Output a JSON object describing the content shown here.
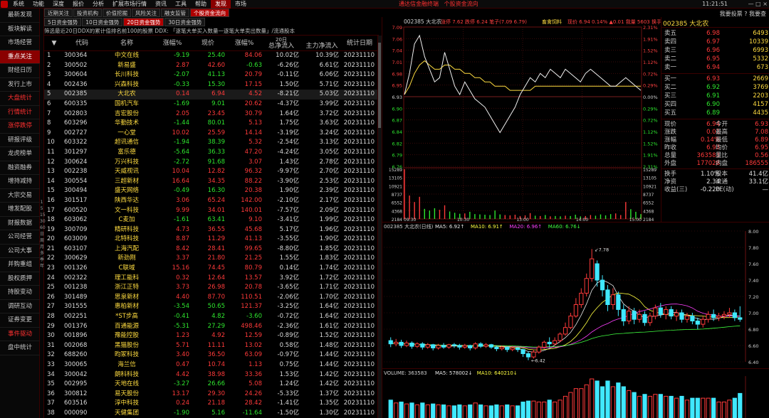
{
  "menubar": {
    "items": [
      "系统",
      "功能",
      "深度",
      "报价",
      "分析",
      "扩展市场行情",
      "资讯",
      "工具",
      "帮助",
      "发现",
      "市场"
    ],
    "active_index": 9,
    "marquee1": "通达信金融终端",
    "marquee2": "个股资金流向",
    "clock": "11:21:51",
    "window_controls": "—  □  ×"
  },
  "sidebar": {
    "items": [
      {
        "label": "最新发现"
      },
      {
        "label": "板块解读"
      },
      {
        "label": "市场经营"
      },
      {
        "label": "重点关注",
        "selected": true
      },
      {
        "label": "财经日历"
      },
      {
        "label": "发行上市"
      },
      {
        "label": "大盘统计",
        "red": true
      },
      {
        "label": "行情统计",
        "red": true
      },
      {
        "label": "涨停跌停",
        "red": true
      },
      {
        "label": "研报评级"
      },
      {
        "label": "龙虎榜单"
      },
      {
        "label": "融资融券"
      },
      {
        "label": "增持减持"
      },
      {
        "label": "大宗交易"
      },
      {
        "label": "增发配股"
      },
      {
        "label": "财报数据"
      },
      {
        "label": "公司经营"
      },
      {
        "label": "公司大事"
      },
      {
        "label": "并购重组"
      },
      {
        "label": "股权质押"
      },
      {
        "label": "持股变动"
      },
      {
        "label": "调研互动"
      },
      {
        "label": "证券变更"
      },
      {
        "label": "事件驱动",
        "red": true
      },
      {
        "label": "盘中统计"
      }
    ],
    "strip": [
      "1",
      "5",
      "15",
      "30",
      "60",
      "日",
      "周",
      "月",
      "多",
      "季",
      "年"
    ]
  },
  "tabs_row1": [
    "近期关注",
    "投资机构",
    "价值挖掘",
    "风险关注",
    "融支监管",
    "个股资金流向"
  ],
  "tabs_row1_active": 5,
  "tabs_row2": [
    "5日资金强势",
    "10日资金强势",
    "20日资金强势",
    "30日资金强势"
  ],
  "tabs_row2_active": 2,
  "toolbar_right": "我要投票  ?  我要查",
  "filter_text": "筛选最近20日DDX的累计值排名前100的股票  DDX: 「逐笔大单买入数量一逐笔大单卖出数量」/流通股本",
  "table": {
    "period_label": "20日",
    "headers": {
      "idx": "",
      "code": "代码",
      "name": "名称",
      "chg": "涨幅%",
      "price": "现价",
      "rate": "涨幅%",
      "net": "总净流入",
      "main": "主力净流入",
      "date": "统计日期"
    },
    "rows": [
      [
        "1",
        "300364",
        "中文在线",
        "-9.19",
        "25.40",
        "84.06",
        "10.02亿",
        "10.39亿",
        "20231110"
      ],
      [
        "2",
        "300502",
        "新易盛",
        "2.87",
        "42.60",
        "-0.63",
        "-6.26亿",
        "6.61亿",
        "20231110"
      ],
      [
        "3",
        "300604",
        "长川科技",
        "-2.07",
        "41.13",
        "20.79",
        "-0.11亿",
        "6.06亿",
        "20231110"
      ],
      [
        "4",
        "002436",
        "兴森科技",
        "-0.33",
        "15.30",
        "17.15",
        "1.50亿",
        "5.71亿",
        "20231110"
      ],
      [
        "5",
        "002385",
        "大北农",
        "0.14",
        "6.94",
        "4.52",
        "-8.21亿",
        "5.03亿",
        "20231110"
      ],
      [
        "6",
        "600335",
        "国机汽车",
        "-1.69",
        "9.01",
        "20.62",
        "-4.37亿",
        "3.99亿",
        "20231110"
      ],
      [
        "7",
        "002803",
        "吉宏股份",
        "2.05",
        "23.45",
        "30.79",
        "1.64亿",
        "3.72亿",
        "20231110"
      ],
      [
        "8",
        "603296",
        "华勤技术",
        "-1.44",
        "80.01",
        "5.13",
        "1.75亿",
        "3.63亿",
        "20231110"
      ],
      [
        "9",
        "002727",
        "一心堂",
        "10.02",
        "25.59",
        "14.14",
        "-3.19亿",
        "3.24亿",
        "20231110"
      ],
      [
        "10",
        "603322",
        "超讯通信",
        "-1.94",
        "38.39",
        "5.32",
        "-2.54亿",
        "3.13亿",
        "20231110"
      ],
      [
        "11",
        "301297",
        "富乐德",
        "-5.64",
        "36.33",
        "47.20",
        "-4.24亿",
        "3.05亿",
        "20231110"
      ],
      [
        "12",
        "300624",
        "万兴科技",
        "-2.72",
        "91.68",
        "3.07",
        "1.43亿",
        "2.78亿",
        "20231110"
      ],
      [
        "13",
        "002238",
        "天威视讯",
        "10.04",
        "12.82",
        "96.32",
        "-9.97亿",
        "2.70亿",
        "20231110"
      ],
      [
        "14",
        "300554",
        "三超新材",
        "16.64",
        "34.35",
        "88.22",
        "-3.90亿",
        "2.53亿",
        "20231110"
      ],
      [
        "15",
        "300494",
        "盛天网络",
        "-0.49",
        "16.30",
        "20.38",
        "1.90亿",
        "2.39亿",
        "20231110"
      ],
      [
        "16",
        "301517",
        "陕西华达",
        "3.06",
        "65.24",
        "142.00",
        "-2.10亿",
        "2.17亿",
        "20231110"
      ],
      [
        "17",
        "600520",
        "文一科技",
        "9.99",
        "34.01",
        "140.01",
        "-7.57亿",
        "2.09亿",
        "20231110"
      ],
      [
        "18",
        "603062",
        "C麦加",
        "-1.61",
        "63.41",
        "9.10",
        "-3.41亿",
        "1.99亿",
        "20231110"
      ],
      [
        "19",
        "300709",
        "精研科技",
        "4.73",
        "36.55",
        "45.68",
        "5.17亿",
        "1.96亿",
        "20231110"
      ],
      [
        "20",
        "603009",
        "北特科技",
        "8.87",
        "11.29",
        "41.13",
        "-3.55亿",
        "1.90亿",
        "20231110"
      ],
      [
        "21",
        "603107",
        "上海汽配",
        "8.42",
        "28.41",
        "99.65",
        "-8.80亿",
        "1.85亿",
        "20231110"
      ],
      [
        "22",
        "300629",
        "新劲刚",
        "3.37",
        "21.80",
        "21.25",
        "1.55亿",
        "1.83亿",
        "20231110"
      ],
      [
        "23",
        "001326",
        "C联域",
        "15.16",
        "74.45",
        "80.79",
        "0.14亿",
        "1.74亿",
        "20231110"
      ],
      [
        "24",
        "002322",
        "理工能科",
        "0.32",
        "12.64",
        "13.57",
        "3.92亿",
        "1.72亿",
        "20231110"
      ],
      [
        "25",
        "001238",
        "浙江正特",
        "3.73",
        "26.98",
        "20.78",
        "-3.65亿",
        "1.71亿",
        "20231110"
      ],
      [
        "26",
        "301489",
        "思泉新材",
        "4.40",
        "87.70",
        "110.51",
        "-2.06亿",
        "1.70亿",
        "20231110"
      ],
      [
        "27",
        "301555",
        "惠柏新材",
        "-3.54",
        "50.65",
        "121.37",
        "-3.25亿",
        "1.64亿",
        "20231110"
      ],
      [
        "28",
        "002251",
        "*ST步高",
        "-0.41",
        "4.82",
        "-3.60",
        "-0.72亿",
        "1.64亿",
        "20231110"
      ],
      [
        "29",
        "001376",
        "百通能源",
        "-5.31",
        "27.29",
        "498.46",
        "-2.36亿",
        "1.61亿",
        "20231110"
      ],
      [
        "30",
        "001896",
        "豫能控股",
        "1.23",
        "4.92",
        "12.59",
        "-0.89亿",
        "1.52亿",
        "20231110"
      ],
      [
        "31",
        "002068",
        "黑猫股份",
        "5.71",
        "11.11",
        "13.02",
        "0.58亿",
        "1.48亿",
        "20231110"
      ],
      [
        "32",
        "688260",
        "昀冢科技",
        "3.40",
        "36.50",
        "63.09",
        "-0.97亿",
        "1.44亿",
        "20231110"
      ],
      [
        "33",
        "300065",
        "海兰信",
        "0.47",
        "10.74",
        "1.13",
        "0.75亿",
        "1.44亿",
        "20231110"
      ],
      [
        "34",
        "300042",
        "朗科科技",
        "4.42",
        "38.98",
        "33.36",
        "1.53亿",
        "1.42亿",
        "20231110"
      ],
      [
        "35",
        "002995",
        "天地在线",
        "-3.27",
        "26.66",
        "5.08",
        "1.24亿",
        "1.42亿",
        "20231110"
      ],
      [
        "36",
        "300812",
        "易天股份",
        "13.17",
        "29.30",
        "24.26",
        "-5.33亿",
        "1.37亿",
        "20231110"
      ],
      [
        "37",
        "603516",
        "淳中科技",
        "0.24",
        "21.18",
        "28.42",
        "-1.41亿",
        "1.35亿",
        "20231110"
      ],
      [
        "38",
        "000090",
        "天健集团",
        "-1.90",
        "5.16",
        "-11.64",
        "-1.50亿",
        "1.30亿",
        "20231110"
      ]
    ]
  },
  "intraday": {
    "header": "002385 大北农",
    "stats": "涨停 7.62  跌停 6.24  笔子(7.09 6.79)",
    "tag": "畜禽饲料",
    "price_text": "现价 6.94  0.14%  ▲0.01  我量 5603  换手 1.10%",
    "price_axis": [
      "7.09",
      "7.06",
      "7.04",
      "7.01",
      "6.98",
      "6.95",
      "6.93",
      "6.90",
      "6.87",
      "6.84",
      "6.82",
      "6.79",
      "6.76"
    ],
    "pct_axis": [
      "2.31%",
      "1.91%",
      "1.52%",
      "1.12%",
      "0.72%",
      "0.29%",
      "0.00%",
      "0.29%",
      "0.72%",
      "1.12%",
      "1.52%",
      "1.91%",
      "2.31%"
    ],
    "vol_axis": [
      "15289",
      "13105",
      "10921",
      "8737",
      "6552",
      "4368",
      "2184"
    ],
    "time_axis": [
      "09:30",
      "10:30",
      "13:00",
      "14:00",
      "15:00"
    ],
    "price_series": [
      6.93,
      6.98,
      7.05,
      7.07,
      7.02,
      6.99,
      6.96,
      6.97,
      7.03,
      6.99,
      6.95,
      6.93,
      6.96,
      6.94,
      6.92,
      6.91,
      6.9,
      6.88,
      6.86,
      6.84,
      6.86,
      6.88,
      6.9,
      6.93,
      6.95,
      6.97,
      6.96,
      6.98,
      6.97,
      6.99,
      6.98,
      6.97,
      6.99,
      6.98,
      6.97,
      6.96,
      6.98,
      6.99,
      6.98,
      6.97,
      6.96,
      6.95,
      6.95,
      6.96,
      6.97,
      6.96,
      6.95,
      6.94
    ],
    "avg_series": [
      6.93,
      6.95,
      6.98,
      7.0,
      7.01,
      7.0,
      6.99,
      6.99,
      7.0,
      7.0,
      6.99,
      6.99,
      6.98,
      6.98,
      6.97,
      6.97,
      6.96,
      6.96,
      6.95,
      6.95,
      6.95,
      6.94,
      6.94,
      6.94,
      6.94,
      6.94,
      6.95,
      6.95,
      6.95,
      6.95,
      6.95,
      6.95,
      6.95,
      6.95,
      6.95,
      6.95,
      6.95,
      6.95,
      6.95,
      6.95,
      6.95,
      6.95,
      6.95,
      6.95,
      6.95,
      6.95,
      6.95,
      6.95
    ],
    "volume_series": [
      15289,
      7200,
      5200,
      6800,
      3100,
      2600,
      3300,
      2800,
      4200,
      2300,
      1900,
      1600,
      1700,
      2200,
      1500,
      1400,
      1300,
      1200,
      2600,
      1400,
      1200,
      1100,
      1300,
      900,
      1100,
      1800,
      1000,
      900,
      1200,
      800,
      900,
      800,
      1000,
      900,
      1300,
      800,
      900,
      1200,
      1000,
      1400,
      1100,
      1500,
      1700,
      1200,
      5200,
      3000,
      2200,
      1500
    ]
  },
  "quote": {
    "title": "002385 大北农",
    "asks": [
      {
        "label": "卖五",
        "price": "6.98",
        "vol": "6493"
      },
      {
        "label": "卖四",
        "price": "6.97",
        "vol": "10339"
      },
      {
        "label": "卖三",
        "price": "6.96",
        "vol": "6993"
      },
      {
        "label": "卖二",
        "price": "6.95",
        "vol": "5332"
      },
      {
        "label": "卖一",
        "price": "6.94",
        "vol": "673"
      }
    ],
    "bids": [
      {
        "label": "买一",
        "price": "6.93",
        "vol": "2669"
      },
      {
        "label": "买二",
        "price": "6.92",
        "vol": "3769"
      },
      {
        "label": "买三",
        "price": "6.91",
        "vol": "2203"
      },
      {
        "label": "买四",
        "price": "6.90",
        "vol": "4157"
      },
      {
        "label": "买五",
        "price": "6.89",
        "vol": "4435"
      }
    ],
    "stats": [
      {
        "l1": "现价",
        "v1": "6.94",
        "l2": "今开",
        "v2": "6.93"
      },
      {
        "l1": "涨跌",
        "v1": "0.01",
        "l2": "最高",
        "v2": "7.08"
      },
      {
        "l1": "涨幅",
        "v1": "0.14%",
        "l2": "最低",
        "v2": "6.89"
      },
      {
        "l1": "昨收",
        "v1": "6.93",
        "l2": "均价",
        "v2": "6.95"
      },
      {
        "l1": "总量",
        "v1": "363583",
        "l2": "量比",
        "v2": "0.56"
      },
      {
        "l1": "外盘",
        "v1": "177028",
        "l2": "内盘",
        "v2": "186555"
      }
    ],
    "stats2": [
      {
        "l1": "换手",
        "v1": "1.10%",
        "l2": "股本",
        "v2": "41.4亿"
      },
      {
        "l1": "净资",
        "v1": "2.34",
        "l2": "流通",
        "v2": "33.1亿"
      },
      {
        "l1": "收益(三)",
        "v1": "-0.220",
        "l2": "PE(动)",
        "v2": "—"
      }
    ]
  },
  "kline": {
    "header": "002385 大北农(日线)",
    "ma_labels": [
      {
        "text": "MA5: 6.92↑",
        "color": "#e8e8e8"
      },
      {
        "text": "MA10: 6.91↑",
        "color": "#ffff40"
      },
      {
        "text": "MA20: 6.96↑",
        "color": "#ff40ff"
      },
      {
        "text": "MA60: 6.76↓",
        "color": "#40ff40"
      }
    ],
    "y_axis": [
      "8.00",
      "7.80",
      "7.60",
      "7.40",
      "7.20",
      "7.00",
      "6.80",
      "6.60",
      "6.40"
    ],
    "high_label": "7.78",
    "low_label": "6.42",
    "candles": [
      [
        6.66,
        6.62,
        6.7,
        6.58
      ],
      [
        6.62,
        6.64,
        6.68,
        6.59
      ],
      [
        6.64,
        6.6,
        6.67,
        6.57
      ],
      [
        6.6,
        6.63,
        6.66,
        6.58
      ],
      [
        6.63,
        6.59,
        6.65,
        6.56
      ],
      [
        6.59,
        6.62,
        6.64,
        6.57
      ],
      [
        6.62,
        6.58,
        6.64,
        6.55
      ],
      [
        6.58,
        6.61,
        6.63,
        6.56
      ],
      [
        6.61,
        6.57,
        6.62,
        6.54
      ],
      [
        6.57,
        6.6,
        6.62,
        6.55
      ],
      [
        6.6,
        6.58,
        6.63,
        6.56
      ],
      [
        6.58,
        6.61,
        6.62,
        6.56
      ],
      [
        6.61,
        6.6,
        6.63,
        6.57
      ],
      [
        6.6,
        6.58,
        6.62,
        6.55
      ],
      [
        6.58,
        6.6,
        6.62,
        6.56
      ],
      [
        6.6,
        6.57,
        6.61,
        6.54
      ],
      [
        6.57,
        6.62,
        6.64,
        6.55
      ],
      [
        6.62,
        6.59,
        6.64,
        6.57
      ],
      [
        6.59,
        6.61,
        6.63,
        6.57
      ],
      [
        6.61,
        6.58,
        6.62,
        6.56
      ],
      [
        6.58,
        6.56,
        6.6,
        6.53
      ],
      [
        6.56,
        6.58,
        6.6,
        6.54
      ],
      [
        6.58,
        6.55,
        6.59,
        6.52
      ],
      [
        6.55,
        6.57,
        6.59,
        6.53
      ],
      [
        6.57,
        6.55,
        6.58,
        6.52
      ],
      [
        6.55,
        6.5,
        6.56,
        6.46
      ],
      [
        6.5,
        6.46,
        6.53,
        6.42
      ],
      [
        6.46,
        6.52,
        6.55,
        6.44
      ],
      [
        6.52,
        6.58,
        6.6,
        6.5
      ],
      [
        6.58,
        6.64,
        6.66,
        6.56
      ],
      [
        6.64,
        6.62,
        6.7,
        6.58
      ],
      [
        6.62,
        6.66,
        6.7,
        6.6
      ],
      [
        6.66,
        6.74,
        6.76,
        6.64
      ],
      [
        6.74,
        6.82,
        6.88,
        6.72
      ],
      [
        6.82,
        6.96,
        7.0,
        6.8
      ],
      [
        6.96,
        7.1,
        7.18,
        6.94
      ],
      [
        7.1,
        7.24,
        7.3,
        7.06
      ],
      [
        7.24,
        7.42,
        7.48,
        7.2
      ],
      [
        7.42,
        7.66,
        7.78,
        7.38
      ],
      [
        7.6,
        7.4,
        7.64,
        7.32
      ],
      [
        7.4,
        7.28,
        7.46,
        7.2
      ],
      [
        7.28,
        7.1,
        7.34,
        7.02
      ],
      [
        7.1,
        7.22,
        7.3,
        7.04
      ],
      [
        7.22,
        7.04,
        7.26,
        6.96
      ],
      [
        7.04,
        6.9,
        7.1,
        6.84
      ],
      [
        6.9,
        7.02,
        7.08,
        6.86
      ],
      [
        7.02,
        6.92,
        7.06,
        6.86
      ],
      [
        6.92,
        6.98,
        7.04,
        6.88
      ],
      [
        6.98,
        6.88,
        7.02,
        6.84
      ],
      [
        6.88,
        6.96,
        7.0,
        6.84
      ],
      [
        6.96,
        7.06,
        7.1,
        6.92
      ],
      [
        7.06,
        6.98,
        7.12,
        6.94
      ],
      [
        6.98,
        7.04,
        7.08,
        6.92
      ],
      [
        7.04,
        6.96,
        7.08,
        6.92
      ],
      [
        6.96,
        7.0,
        7.04,
        6.9
      ],
      [
        7.0,
        6.92,
        7.04,
        6.88
      ],
      [
        6.92,
        6.96,
        7.0,
        6.88
      ],
      [
        6.96,
        6.9,
        7.0,
        6.86
      ],
      [
        6.9,
        6.86,
        6.94,
        6.8
      ],
      [
        6.86,
        6.92,
        6.96,
        6.82
      ],
      [
        6.92,
        6.98,
        7.02,
        6.88
      ],
      [
        6.98,
        6.94,
        7.04,
        6.9
      ],
      [
        6.94,
        6.96,
        7.0,
        6.9
      ],
      [
        6.96,
        6.98,
        7.02,
        6.92
      ],
      [
        6.98,
        7.0,
        7.06,
        6.94
      ],
      [
        7.0,
        6.94,
        7.04,
        6.9
      ],
      [
        6.94,
        6.92,
        7.08,
        6.89
      ]
    ],
    "volume_header": "VOLUME: 363583",
    "volume_ma": [
      {
        "text": "MA5: 578002↓",
        "color": "#e8e8e8"
      },
      {
        "text": "MA10: 640210↓",
        "color": "#ffff40"
      }
    ]
  }
}
